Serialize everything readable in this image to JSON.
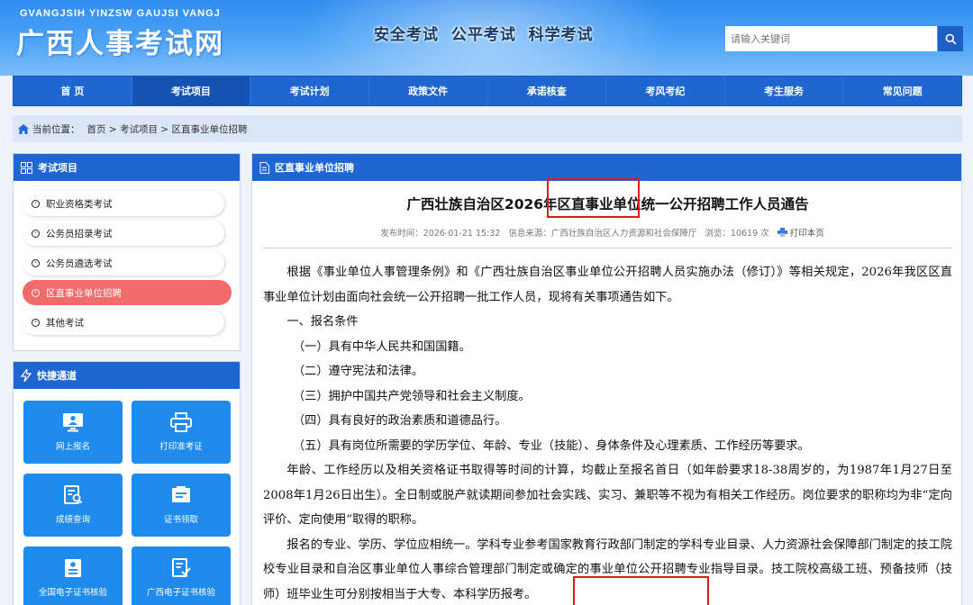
{
  "header": {
    "site_en": "GVANGJSIH YINZSW GAUJSI VANGJ",
    "site_cn": "广西人事考试网",
    "slogan": "安全考试  公平考试  科学考试",
    "search_placeholder": "请输入关键词"
  },
  "nav": [
    "首 页",
    "考试项目",
    "考试计划",
    "政策文件",
    "承诺核查",
    "考风考纪",
    "考生服务",
    "常见问题"
  ],
  "breadcrumb": {
    "label": "当前位置：",
    "path": "首页 > 考试项目 > 区直事业单位招聘"
  },
  "sidebar": {
    "exam_title": "考试项目",
    "items": [
      "职业资格类考试",
      "公务员招录考试",
      "公务员遴选考试",
      "区直事业单位招聘",
      "其他考试"
    ],
    "quick_title": "快捷通道",
    "tiles": [
      "网上报名",
      "打印准考证",
      "成绩查询",
      "证书领取",
      "全国电子证书核验",
      "广西电子证书核验"
    ]
  },
  "article": {
    "section": "区直事业单位招聘",
    "title": "广西壮族自治区2026年区直事业单位统一公开招聘工作人员通告",
    "meta": {
      "published": "发布时间：2026-01-21 15:32",
      "source": "信息来源：广西壮族自治区人力资源和社会保障厅",
      "views": "浏览：10619 次",
      "print": "打印本页"
    },
    "paragraphs": [
      "根据《事业单位人事管理条例》和《广西壮族自治区事业单位公开招聘人员实施办法（修订）》等相关规定，2026年我区区直事业单位计划由面向社会统一公开招聘一批工作人员，现将有关事项通告如下。",
      "一、报名条件",
      "（一）具有中华人民共和国国籍。",
      "（二）遵守宪法和法律。",
      "（三）拥护中国共产党领导和社会主义制度。",
      "（四）具有良好的政治素质和道德品行。",
      "（五）具有岗位所需要的学历学位、年龄、专业（技能）、身体条件及心理素质、工作经历等要求。",
      "年龄、工作经历以及相关资格证书取得等时间的计算，均截止至报名首日（如年龄要求18-38周岁的，为1987年1月27日至2008年1月26日出生）。全日制或脱产就读期间参加社会实践、实习、兼职等不视为有相关工作经历。岗位要求的职称均为非“定向评价、定向使用”取得的职称。",
      "报名的专业、学历、学位应相统一。学科专业参考国家教育行政部门制定的学科专业目录、人力资源社会保障部门制定的技工院校专业目录和自治区事业单位人事综合管理部门制定或确定的事业单位公开招聘专业指导目录。技工院校高级工班、预备技师（技师）班毕业生可分别按相当于大专、本科学历报考。"
    ]
  }
}
